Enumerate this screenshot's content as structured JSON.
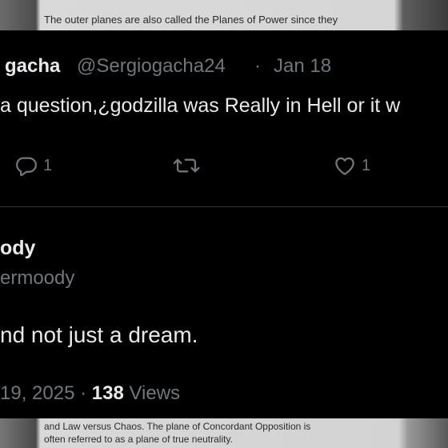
{
  "background": {
    "top_text": "The outer planes are also called the Planes of Power since they",
    "bottom_line1": "and Law versus Chaos. The plane of Concordant Opposition is",
    "bottom_line2": "often referred to as a plane of true neutrality."
  },
  "tweet1": {
    "name": "gacha",
    "handle": "@Sergiogacha24",
    "separator": "·",
    "date": "Jan 18",
    "text": "a question,¿godzilla was Really in Hell or it w",
    "reply_count": "1",
    "like_count": "1",
    "icons": [
      "reply-icon",
      "retweet-icon",
      "like-icon"
    ]
  },
  "tweet2": {
    "name": "ody",
    "handle": "ermoody",
    "text": "nd not just a dream.",
    "date": "19, 2025",
    "separator": "·",
    "views_count": "138",
    "views_label": "Views"
  },
  "colors": {
    "background": "#000000",
    "primary_text": "#e7e9ea",
    "secondary_text": "#71767b",
    "divider": "#2f3336"
  }
}
